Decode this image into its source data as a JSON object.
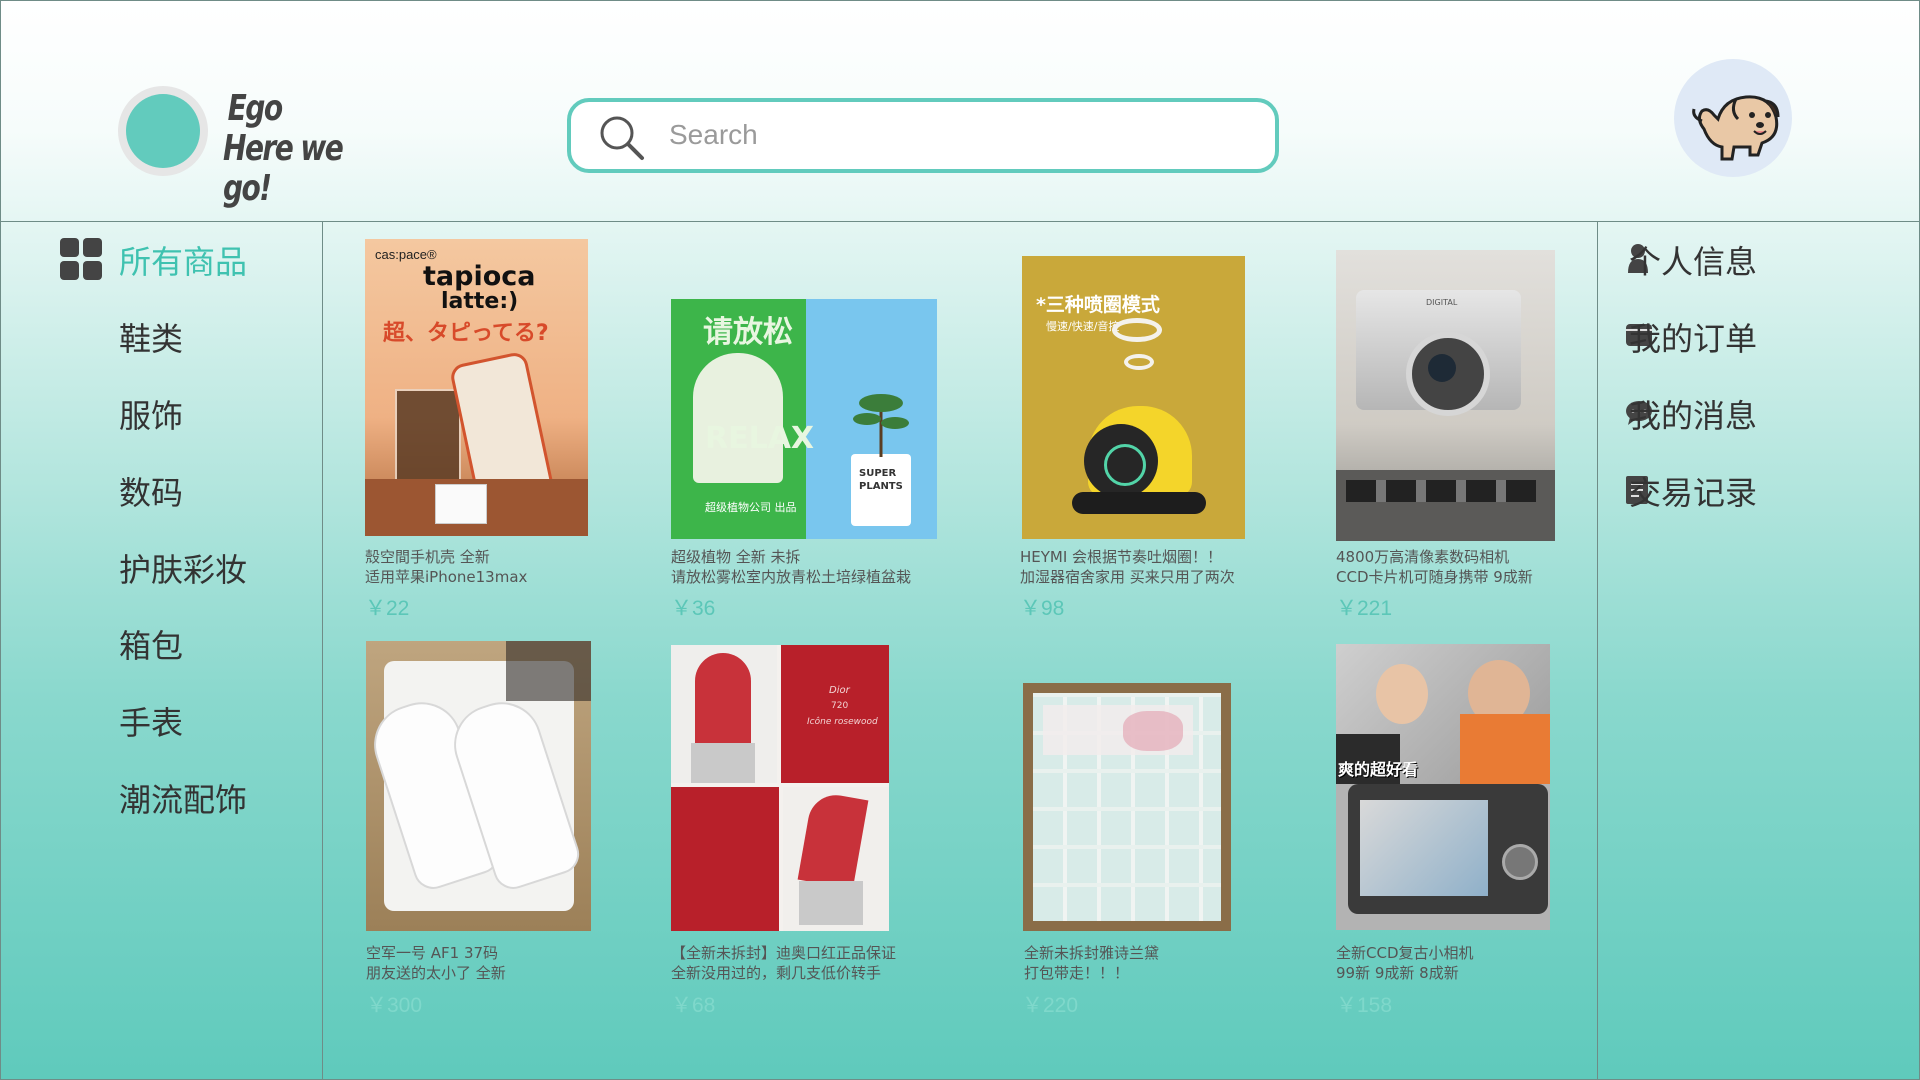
{
  "brand": {
    "line1": "Ego",
    "line2": "Here we go!"
  },
  "search": {
    "placeholder": "Search"
  },
  "categories": [
    {
      "label": "所有商品",
      "active": true
    },
    {
      "label": "鞋类"
    },
    {
      "label": "服饰"
    },
    {
      "label": "数码"
    },
    {
      "label": "护肤彩妆"
    },
    {
      "label": "箱包"
    },
    {
      "label": "手表"
    },
    {
      "label": "潮流配饰"
    }
  ],
  "user_menu": [
    {
      "label": "个人信息",
      "icon": "person-icon"
    },
    {
      "label": "我的订单",
      "icon": "wallet-icon"
    },
    {
      "label": "我的消息",
      "icon": "chat-bubble-icon"
    },
    {
      "label": "交易记录",
      "icon": "document-icon"
    }
  ],
  "products": [
    {
      "line1": "殼空間手机壳 全新",
      "line2": "适用苹果iPhone13max",
      "price": "￥22",
      "img_text": {
        "brand": "cas:pace®",
        "title1": "tapioca",
        "title2": "latte:)",
        "jp": "超、タピってる?"
      }
    },
    {
      "line1": "超级植物  全新 未拆",
      "line2": "请放松雾松室内放青松土培绿植盆栽",
      "price": "￥36",
      "img_text": {
        "title": "请放松",
        "relax": "RELAX",
        "company": "超级植物公司  出品",
        "pot": "SUPER PLANTS"
      }
    },
    {
      "line1": "HEYMI  会根据节奏吐烟圈！！",
      "line2": "加湿器宿舍家用  买来只用了两次",
      "price": "￥98",
      "img_text": {
        "title": "*三种喷圈模式",
        "sub": "慢速/快速/音控"
      }
    },
    {
      "line1": "4800万高清像素数码相机",
      "line2": "CCD卡片机可随身携带 9成新",
      "price": "￥221",
      "img_text": {
        "badge": "DIGITAL"
      }
    },
    {
      "line1": "空军一号 AF1 37码",
      "line2": "朋友送的太小了 全新",
      "price": "￥300",
      "img_text": {}
    },
    {
      "line1": "【全新未拆封】迪奥口红正品保证",
      "line2": "全新没用过的，剩几支低价转手",
      "price": "￥68",
      "img_text": {
        "brand": "Dior",
        "shade": "720",
        "name": "Icône rosewood"
      }
    },
    {
      "line1": "全新未拆封雅诗兰黛",
      "line2": "打包带走！！！",
      "price": "￥220",
      "img_text": {}
    },
    {
      "line1": "全新CCD复古小相机",
      "line2": "99新 9成新 8成新",
      "price": "￥158",
      "img_text": {
        "sticker": "爽的超好看"
      }
    }
  ],
  "colors": {
    "accent": "#62cbbd",
    "active_text": "#3fc2b0",
    "price": "#5cc7b8"
  }
}
